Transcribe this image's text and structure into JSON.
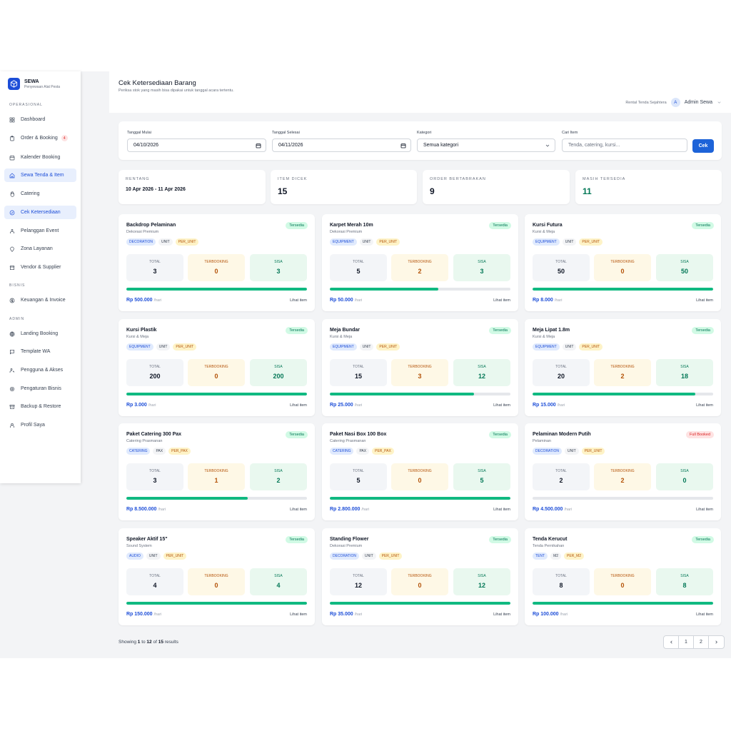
{
  "brand": {
    "name": "SEWA",
    "sub": "Penyewaan Alat Pesta"
  },
  "sidebar": {
    "sections": [
      {
        "label": "OPERASIONAL"
      },
      {
        "label": "BISNIS"
      },
      {
        "label": "ADMIN"
      }
    ],
    "items": [
      {
        "label": "Dashboard",
        "icon": "grid-icon"
      },
      {
        "label": "Order & Booking",
        "icon": "clipboard-icon",
        "badge": "4"
      },
      {
        "label": "Kalender Booking",
        "icon": "calendar-icon"
      },
      {
        "label": "Sewa Tenda & Item",
        "icon": "home-icon"
      },
      {
        "label": "Catering",
        "icon": "hand-icon"
      },
      {
        "label": "Cek Ketersediaan",
        "icon": "check-circle-icon"
      },
      {
        "label": "Pelanggan Event",
        "icon": "users-icon"
      },
      {
        "label": "Zona Layanan",
        "icon": "map-pin-icon"
      },
      {
        "label": "Vendor & Supplier",
        "icon": "store-icon"
      },
      {
        "label": "Keuangan & Invoice",
        "icon": "dollar-icon"
      },
      {
        "label": "Landing Booking",
        "icon": "globe-icon"
      },
      {
        "label": "Template WA",
        "icon": "chat-icon"
      },
      {
        "label": "Pengguna & Akses",
        "icon": "user-key-icon"
      },
      {
        "label": "Pengaturan Bisnis",
        "icon": "settings-icon"
      },
      {
        "label": "Backup & Restore",
        "icon": "archive-icon"
      },
      {
        "label": "Profil Saya",
        "icon": "user-icon"
      }
    ]
  },
  "header": {
    "title": "Cek Ketersediaan Barang",
    "subtitle": "Periksa stok yang masih bisa dipakai untuk tanggal acara tertentu.",
    "company": "Rental Tenda Sejahtera",
    "avatar": "A",
    "user": "Admin Sewa"
  },
  "filters": {
    "start_label": "Tanggal Mulai",
    "start_value": "04/10/2026",
    "end_label": "Tanggal Selesai",
    "end_value": "04/11/2026",
    "category_label": "Kategori",
    "category_value": "Semua kategori",
    "search_label": "Cari Item",
    "search_placeholder": "Tenda, catering, kursi...",
    "button": "Cek"
  },
  "stats": [
    {
      "label": "RENTANG",
      "value": "10 Apr 2026 - 11 Apr 2026"
    },
    {
      "label": "ITEM DICEK",
      "value": "15"
    },
    {
      "label": "ORDER BERTABRAKAN",
      "value": "9"
    },
    {
      "label": "MASIH TERSEDIA",
      "value": "11"
    }
  ],
  "labels": {
    "total": "TOTAL",
    "booked": "TERBOOKING",
    "remaining": "SISA",
    "link": "Lihat item",
    "per_day": "/hari"
  },
  "items": [
    {
      "name": "Backdrop Pelaminan",
      "category": "Dekorasi Premium",
      "status": "Tersedia",
      "tags": [
        "DECORATION",
        "UNIT",
        "PER_UNIT"
      ],
      "total": "3",
      "booked": "0",
      "remaining": "3",
      "available_pct": 100,
      "price": "Rp 500.000"
    },
    {
      "name": "Karpet Merah 10m",
      "category": "Dekorasi Premium",
      "status": "Tersedia",
      "tags": [
        "EQUIPMENT",
        "UNIT",
        "PER_UNIT"
      ],
      "total": "5",
      "booked": "2",
      "remaining": "3",
      "available_pct": 60,
      "price": "Rp 50.000"
    },
    {
      "name": "Kursi Futura",
      "category": "Kursi & Meja",
      "status": "Tersedia",
      "tags": [
        "EQUIPMENT",
        "UNIT",
        "PER_UNIT"
      ],
      "total": "50",
      "booked": "0",
      "remaining": "50",
      "available_pct": 100,
      "price": "Rp 8.000"
    },
    {
      "name": "Kursi Plastik",
      "category": "Kursi & Meja",
      "status": "Tersedia",
      "tags": [
        "EQUIPMENT",
        "UNIT",
        "PER_UNIT"
      ],
      "total": "200",
      "booked": "0",
      "remaining": "200",
      "available_pct": 100,
      "price": "Rp 3.000"
    },
    {
      "name": "Meja Bundar",
      "category": "Kursi & Meja",
      "status": "Tersedia",
      "tags": [
        "EQUIPMENT",
        "UNIT",
        "PER_UNIT"
      ],
      "total": "15",
      "booked": "3",
      "remaining": "12",
      "available_pct": 80,
      "price": "Rp 25.000"
    },
    {
      "name": "Meja Lipat 1.8m",
      "category": "Kursi & Meja",
      "status": "Tersedia",
      "tags": [
        "EQUIPMENT",
        "UNIT",
        "PER_UNIT"
      ],
      "total": "20",
      "booked": "2",
      "remaining": "18",
      "available_pct": 90,
      "price": "Rp 15.000"
    },
    {
      "name": "Paket Catering 300 Pax",
      "category": "Catering Prasmanan",
      "status": "Tersedia",
      "tags": [
        "CATERING",
        "PAX",
        "PER_PAX"
      ],
      "total": "3",
      "booked": "1",
      "remaining": "2",
      "available_pct": 67,
      "price": "Rp 8.500.000"
    },
    {
      "name": "Paket Nasi Box 100 Box",
      "category": "Catering Prasmanan",
      "status": "Tersedia",
      "tags": [
        "CATERING",
        "PAX",
        "PER_PAX"
      ],
      "total": "5",
      "booked": "0",
      "remaining": "5",
      "available_pct": 100,
      "price": "Rp 2.800.000"
    },
    {
      "name": "Pelaminan Modern Putih",
      "category": "Pelaminan",
      "status": "Full Booked",
      "tags": [
        "DECORATION",
        "UNIT",
        "PER_UNIT"
      ],
      "total": "2",
      "booked": "2",
      "remaining": "0",
      "available_pct": 0,
      "price": "Rp 4.500.000"
    },
    {
      "name": "Speaker Aktif 15\"",
      "category": "Sound System",
      "status": "Tersedia",
      "tags": [
        "AUDIO",
        "UNIT",
        "PER_UNIT"
      ],
      "total": "4",
      "booked": "0",
      "remaining": "4",
      "available_pct": 100,
      "price": "Rp 150.000"
    },
    {
      "name": "Standing Flower",
      "category": "Dekorasi Premium",
      "status": "Tersedia",
      "tags": [
        "DECORATION",
        "UNIT",
        "PER_UNIT"
      ],
      "total": "12",
      "booked": "0",
      "remaining": "12",
      "available_pct": 100,
      "price": "Rp 35.000"
    },
    {
      "name": "Tenda Kerucut",
      "category": "Tenda Pernikahan",
      "status": "Tersedia",
      "tags": [
        "TENT",
        "M2",
        "PER_M2"
      ],
      "total": "8",
      "booked": "0",
      "remaining": "8",
      "available_pct": 100,
      "price": "Rp 100.000"
    }
  ],
  "pagination": {
    "prefix": "Showing",
    "from": "1",
    "to_word": "to",
    "to": "12",
    "of_word": "of",
    "total": "15",
    "suffix": "results",
    "pages": [
      "1",
      "2"
    ]
  },
  "colors": {
    "accent": "#1d63d8",
    "success": "#10b981",
    "danger": "#dc2626",
    "warning": "#b45309"
  }
}
